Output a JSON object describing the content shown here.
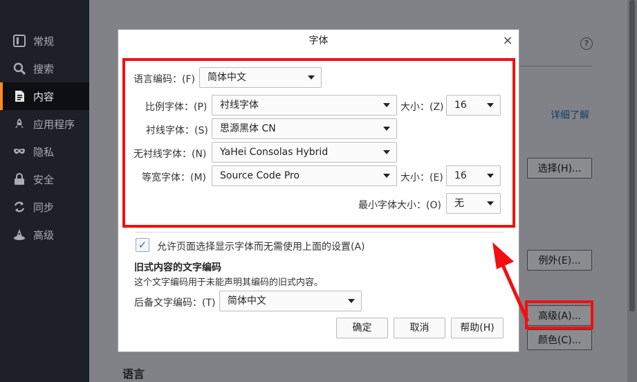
{
  "sidebar": {
    "items": [
      {
        "label": "常规",
        "icon": "general-icon"
      },
      {
        "label": "搜索",
        "icon": "search-icon"
      },
      {
        "label": "内容",
        "icon": "content-icon",
        "active": true
      },
      {
        "label": "应用程序",
        "icon": "rocket-icon"
      },
      {
        "label": "隐私",
        "icon": "mask-icon"
      },
      {
        "label": "安全",
        "icon": "lock-icon"
      },
      {
        "label": "同步",
        "icon": "sync-icon"
      },
      {
        "label": "高级",
        "icon": "wizard-hat-icon"
      }
    ]
  },
  "background": {
    "help_glyph": "?",
    "learn_more": "详细了解",
    "select_button": "选择(H)...",
    "exceptions_button": "例外(E)...",
    "advanced_button": "高级(A)...",
    "colors_button": "颜色(C)...",
    "language_heading": "语言"
  },
  "dialog": {
    "title": "字体",
    "close_glyph": "×",
    "language_label": "语言编码：(F)",
    "language_value": "简体中文",
    "proportional_label": "比例字体：(P)",
    "proportional_value": "衬线字体",
    "size_label_1": "大小：(Z)",
    "size_value_1": "16",
    "serif_label": "衬线字体：(S)",
    "serif_value": "思源黑体 CN",
    "sans_label": "无衬线字体：(N)",
    "sans_value": "YaHei Consolas Hybrid",
    "mono_label": "等宽字体：(M)",
    "mono_value": "Source Code Pro",
    "size_label_2": "大小：(E)",
    "size_value_2": "16",
    "min_size_label": "最小字体大小：(O)",
    "min_size_value": "无",
    "allow_pages_label": "允许页面选择显示字体而无需使用上面的设置(A)",
    "allow_pages_checked": true,
    "check_glyph": "✓",
    "legacy_heading": "旧式内容的文字编码",
    "legacy_desc": "这个文字编码用于未能声明其编码的旧式内容。",
    "fallback_label": "后备文字编码：(T)",
    "fallback_value": "简体中文",
    "ok_button": "确定",
    "cancel_button": "取消",
    "help_button": "帮助(H)"
  },
  "annotation": {
    "color": "#f20f0f"
  }
}
